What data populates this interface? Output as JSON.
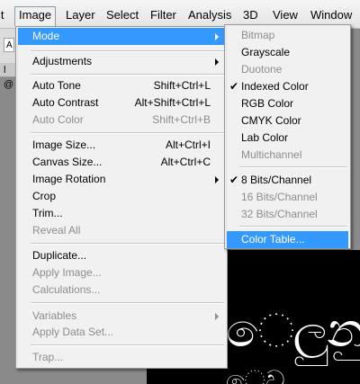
{
  "menubar": {
    "items": [
      "it",
      "Image",
      "Layer",
      "Select",
      "Filter",
      "Analysis",
      "3D",
      "View",
      "Window"
    ]
  },
  "options_bar": {
    "field": "A"
  },
  "doc_tab": {
    "label": "l @"
  },
  "canvas": {
    "text_main": "ෙලුනු ශ",
    "text_sub": "ෙව"
  },
  "image_menu": {
    "mode": "Mode",
    "adjustments": "Adjustments",
    "auto_tone": {
      "label": "Auto Tone",
      "shortcut": "Shift+Ctrl+L"
    },
    "auto_contrast": {
      "label": "Auto Contrast",
      "shortcut": "Alt+Shift+Ctrl+L"
    },
    "auto_color": {
      "label": "Auto Color",
      "shortcut": "Shift+Ctrl+B"
    },
    "image_size": {
      "label": "Image Size...",
      "shortcut": "Alt+Ctrl+I"
    },
    "canvas_size": {
      "label": "Canvas Size...",
      "shortcut": "Alt+Ctrl+C"
    },
    "image_rotation": "Image Rotation",
    "crop": "Crop",
    "trim": "Trim...",
    "reveal_all": "Reveal All",
    "duplicate": "Duplicate...",
    "apply_image": "Apply Image...",
    "calculations": "Calculations...",
    "variables": "Variables",
    "apply_data_set": "Apply Data Set...",
    "trap": "Trap..."
  },
  "mode_menu": {
    "bitmap": "Bitmap",
    "grayscale": "Grayscale",
    "duotone": "Duotone",
    "indexed_color": "Indexed Color",
    "rgb_color": "RGB Color",
    "cmyk_color": "CMYK Color",
    "lab_color": "Lab Color",
    "multichannel": "Multichannel",
    "bits8": "8 Bits/Channel",
    "bits16": "16 Bits/Channel",
    "bits32": "32 Bits/Channel",
    "color_table": "Color Table...",
    "check_glyph": "✔"
  },
  "colors": {
    "highlight": "#3399ff",
    "disabled": "#8d8d8d",
    "menu_bg": "#f1f1f1"
  }
}
